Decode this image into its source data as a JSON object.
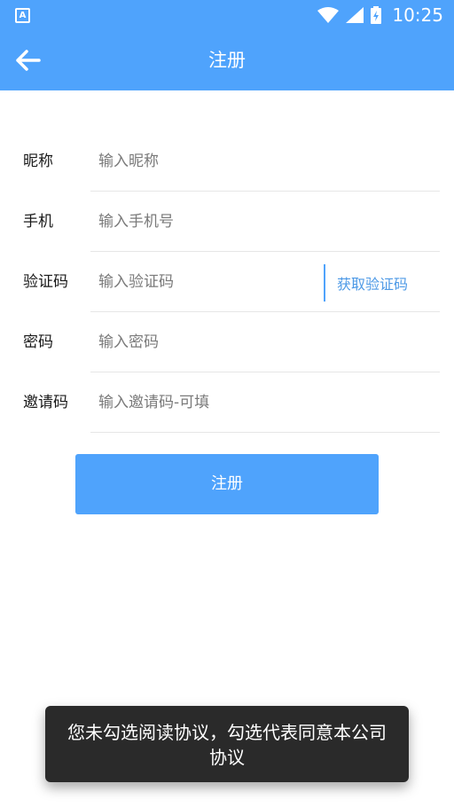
{
  "status_bar": {
    "time": "10:25",
    "icons": [
      "notification-a-icon",
      "wifi-icon",
      "signal-icon",
      "battery-icon"
    ]
  },
  "header": {
    "title": "注册",
    "back_icon": "arrow-left-icon"
  },
  "form": {
    "nickname": {
      "label": "昵称",
      "placeholder": "输入昵称"
    },
    "phone": {
      "label": "手机",
      "placeholder": "输入手机号"
    },
    "code": {
      "label": "验证码",
      "placeholder": "输入验证码",
      "get_code": "获取验证码"
    },
    "password": {
      "label": "密码",
      "placeholder": "输入密码"
    },
    "invite": {
      "label": "邀请码",
      "placeholder": "输入邀请码-可填"
    }
  },
  "submit_label": "注册",
  "toast_text": "您未勾选阅读协议，勾选代表同意本公司协议",
  "colors": {
    "primary": "#4fa3fc",
    "link": "#4d99e6",
    "toast_bg": "#2a2a2a"
  }
}
